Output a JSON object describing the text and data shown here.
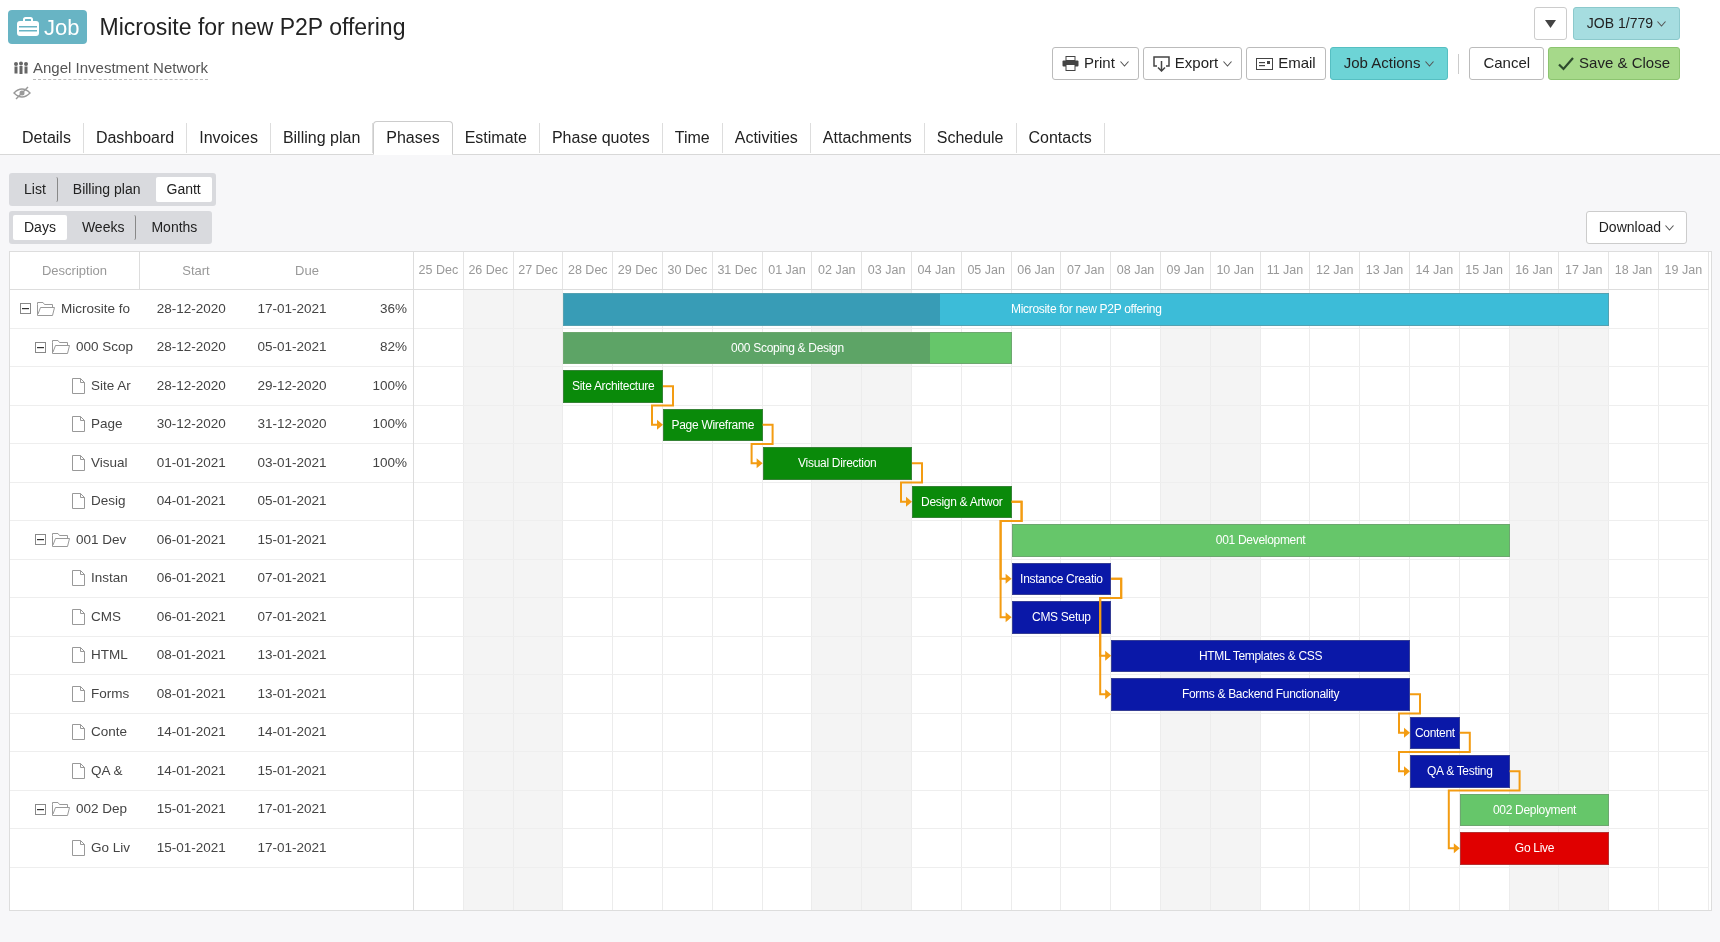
{
  "header": {
    "badge": "Job",
    "title": "Microsite for new P2P offering",
    "client": "Angel Investment Network",
    "record_button": "JOB 1/779"
  },
  "actions": [
    {
      "label": "Print",
      "kind": "print"
    },
    {
      "label": "Export",
      "kind": "export"
    },
    {
      "label": "Email",
      "kind": "email"
    },
    {
      "label": "Job Actions",
      "kind": "dropdown"
    },
    {
      "label": "Cancel",
      "kind": "plain"
    },
    {
      "label": "Save & Close",
      "kind": "confirm"
    }
  ],
  "tabs": [
    {
      "label": "Details",
      "selected": false
    },
    {
      "label": "Dashboard",
      "selected": false
    },
    {
      "label": "Invoices",
      "selected": false
    },
    {
      "label": "Billing plan",
      "selected": false
    },
    {
      "label": "Phases",
      "selected": true
    },
    {
      "label": "Estimate",
      "selected": false
    },
    {
      "label": "Phase quotes",
      "selected": false
    },
    {
      "label": "Time",
      "selected": false
    },
    {
      "label": "Activities",
      "selected": false
    },
    {
      "label": "Attachments",
      "selected": false
    },
    {
      "label": "Schedule",
      "selected": false
    },
    {
      "label": "Contacts",
      "selected": false
    }
  ],
  "views": [
    {
      "label": "List",
      "selected": false
    },
    {
      "label": "Billing plan",
      "selected": false
    },
    {
      "label": "Gantt",
      "selected": true
    }
  ],
  "scales": [
    {
      "label": "Days",
      "selected": true
    },
    {
      "label": "Weeks",
      "selected": false
    },
    {
      "label": "Months",
      "selected": false
    }
  ],
  "download_button": "Download",
  "gantt": {
    "columns": [
      "Description",
      "Start",
      "Due"
    ],
    "days": [
      "25 Dec",
      "26 Dec",
      "27 Dec",
      "28 Dec",
      "29 Dec",
      "30 Dec",
      "31 Dec",
      "01 Jan",
      "02 Jan",
      "03 Jan",
      "04 Jan",
      "05 Jan",
      "06 Jan",
      "07 Jan",
      "08 Jan",
      "09 Jan",
      "10 Jan",
      "11 Jan",
      "12 Jan",
      "13 Jan",
      "14 Jan",
      "15 Jan",
      "16 Jan",
      "17 Jan",
      "18 Jan",
      "19 Jan"
    ],
    "rows": [
      {
        "kind": "project",
        "description": "Microsite fo",
        "start": "28-12-2020",
        "due": "17-01-2021",
        "percent": "36%",
        "level": 0.36,
        "expanded": true,
        "bar_label": "Microsite for new P2P offering",
        "children": [
          {
            "kind": "phase",
            "description": "000 Scop",
            "start": "28-12-2020",
            "due": "05-01-2021",
            "percent": "82%",
            "level": 0.82,
            "expanded": true,
            "bar_label": "000 Scoping & Design",
            "children": [
              {
                "kind": "task",
                "description": "Site Ar",
                "start": "28-12-2020",
                "due": "29-12-2020",
                "percent": "100%",
                "bar_label": "Site Architecture",
                "color": "#0a8a0a",
                "linked": false
              },
              {
                "kind": "task",
                "description": "Page",
                "start": "30-12-2020",
                "due": "31-12-2020",
                "percent": "100%",
                "bar_label": "Page Wireframe",
                "color": "#0a8a0a",
                "linked": true
              },
              {
                "kind": "task",
                "description": "Visual",
                "start": "01-01-2021",
                "due": "03-01-2021",
                "percent": "100%",
                "bar_label": "Visual Direction",
                "color": "#0a8a0a",
                "linked": true
              },
              {
                "kind": "task",
                "description": "Desig",
                "start": "04-01-2021",
                "due": "05-01-2021",
                "bar_label": "Design & Artwor",
                "color": "#0a8a0a",
                "linked": true
              }
            ]
          },
          {
            "kind": "phase",
            "description": "001 Dev",
            "start": "06-01-2021",
            "due": "15-01-2021",
            "expanded": true,
            "bar_label": "001 Development",
            "children": [
              {
                "kind": "task",
                "description": "Instan",
                "start": "06-01-2021",
                "due": "07-01-2021",
                "bar_label": "Instance Creatio",
                "color": "#0a18a8",
                "linked": true
              },
              {
                "kind": "task",
                "description": "CMS",
                "start": "06-01-2021",
                "due": "07-01-2021",
                "bar_label": "CMS Setup",
                "color": "#0a18a8",
                "linked": true,
                "skips_task": true
              },
              {
                "kind": "task",
                "description": "HTML",
                "start": "08-01-2021",
                "due": "13-01-2021",
                "bar_label": "HTML Templates & CSS",
                "color": "#0a18a8",
                "linked": true,
                "skips_task": true
              },
              {
                "kind": "task",
                "description": "Forms",
                "start": "08-01-2021",
                "due": "13-01-2021",
                "bar_label": "Forms & Backend Functionality",
                "color": "#0a18a8",
                "linked": true,
                "skips_two_tasks": true
              },
              {
                "kind": "task",
                "description": "Conte",
                "start": "14-01-2021",
                "due": "14-01-2021",
                "bar_label": "Content",
                "color": "#0a18a8",
                "linked": true
              },
              {
                "kind": "task",
                "description": "QA &",
                "start": "14-01-2021",
                "due": "15-01-2021",
                "bar_label": "QA & Testing",
                "color": "#0a18a8",
                "linked": true
              }
            ]
          },
          {
            "kind": "phase",
            "description": "002 Dep",
            "start": "15-01-2021",
            "due": "17-01-2021",
            "expanded": true,
            "bar_label": "002 Deployment",
            "children": [
              {
                "kind": "task",
                "description": "Go Liv",
                "start": "15-01-2021",
                "due": "17-01-2021",
                "bar_label": "Go Live",
                "color": "#e00000",
                "linked": true
              }
            ]
          }
        ]
      }
    ]
  }
}
